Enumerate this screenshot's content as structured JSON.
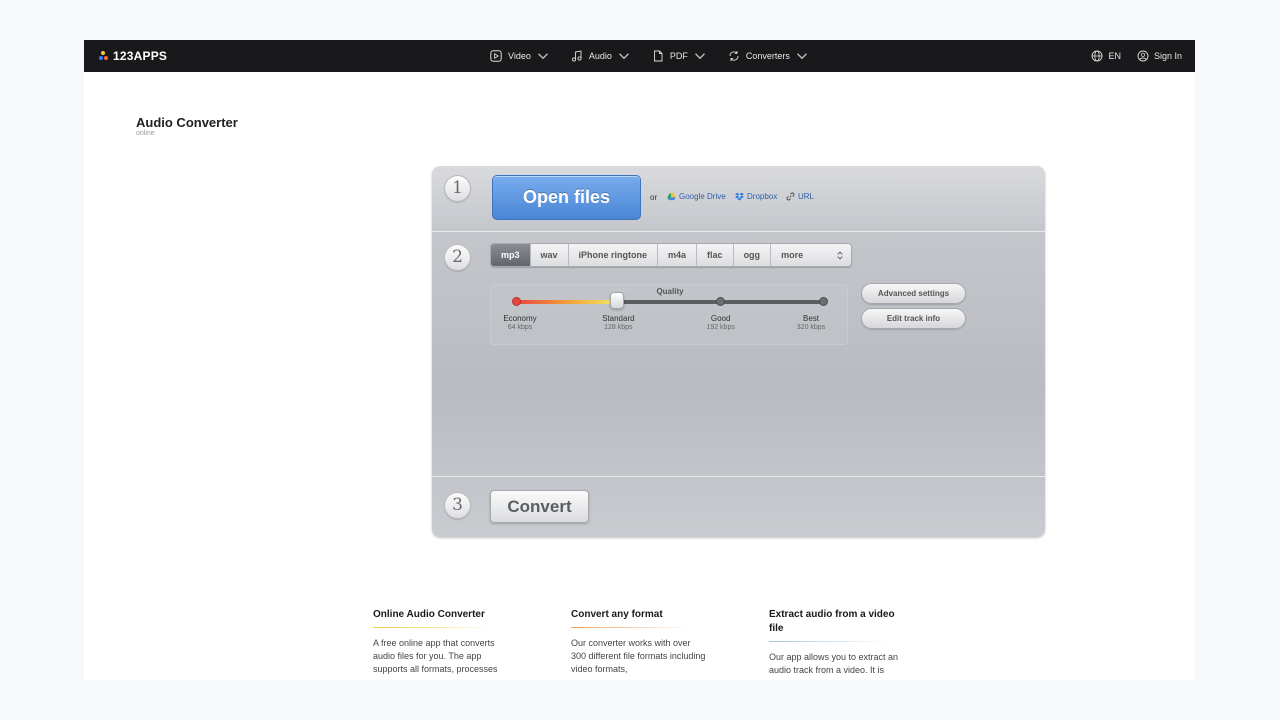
{
  "header": {
    "logo_text": "123APPS",
    "logo_colors": [
      "#3e7bff",
      "#ff6a3d",
      "#ffc43d"
    ],
    "nav": [
      {
        "label": "Video",
        "icon": "play-icon"
      },
      {
        "label": "Audio",
        "icon": "music-note-icon"
      },
      {
        "label": "PDF",
        "icon": "document-icon"
      },
      {
        "label": "Converters",
        "icon": "refresh-icon"
      }
    ],
    "language": "EN",
    "sign_in": "Sign In"
  },
  "app": {
    "title": "Audio Converter",
    "subtitle": "online"
  },
  "step1": {
    "number": "1",
    "open_files": "Open files",
    "or": "or",
    "sources": [
      {
        "label": "Google Drive",
        "icon": "google-drive-icon"
      },
      {
        "label": "Dropbox",
        "icon": "dropbox-icon"
      },
      {
        "label": "URL",
        "icon": "link-icon"
      }
    ]
  },
  "step2": {
    "number": "2",
    "formats": [
      "mp3",
      "wav",
      "iPhone ringtone",
      "m4a",
      "flac",
      "ogg"
    ],
    "active_format": "mp3",
    "more": "more",
    "quality": {
      "label": "Quality",
      "levels": [
        {
          "name": "Economy",
          "kbps": "64 kbps"
        },
        {
          "name": "Standard",
          "kbps": "128 kbps"
        },
        {
          "name": "Good",
          "kbps": "192 kbps"
        },
        {
          "name": "Best",
          "kbps": "320 kbps"
        }
      ],
      "selected_index": 1,
      "selected_fraction": 0.33
    },
    "advanced_settings": "Advanced settings",
    "edit_track_info": "Edit track info"
  },
  "step3": {
    "number": "3",
    "convert": "Convert"
  },
  "info": [
    {
      "title": "Online Audio Converter",
      "rule_color": "#f0c93a",
      "text": "A free online app that converts audio files for you. The app supports all formats, processes"
    },
    {
      "title": "Convert any format",
      "rule_color": "#f0a05a",
      "text": "Our converter works with over 300 different file formats including video formats,"
    },
    {
      "title": "Extract audio from a video file",
      "rule_color": "#9cc8e6",
      "text": "Our app allows you to extract an audio track from a video. It is"
    }
  ]
}
